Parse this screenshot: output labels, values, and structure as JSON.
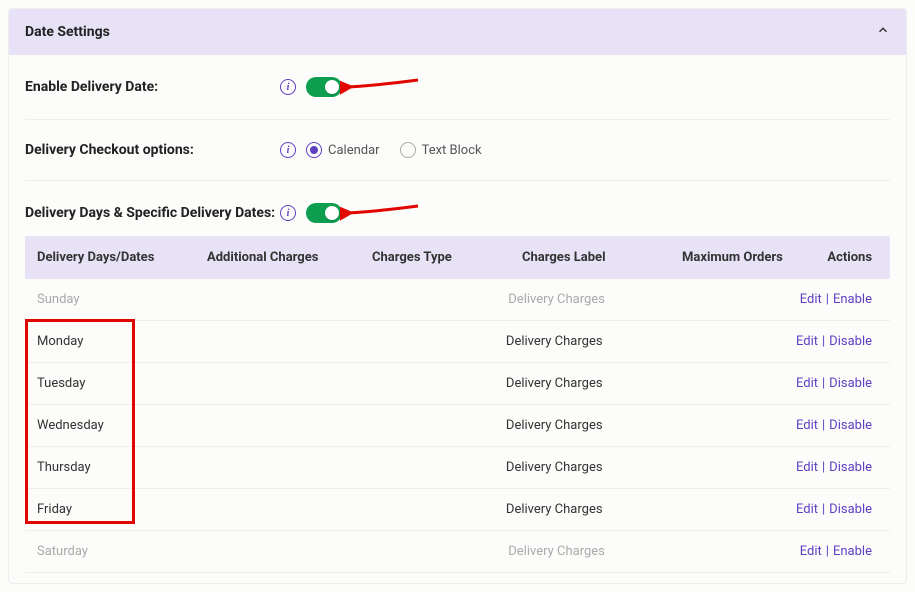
{
  "panel": {
    "title": "Date Settings"
  },
  "settings": {
    "enable_label": "Enable Delivery Date:",
    "checkout_label": "Delivery Checkout options:",
    "checkout_options": {
      "calendar": "Calendar",
      "textblock": "Text Block"
    },
    "days_label": "Delivery Days & Specific Delivery Dates:"
  },
  "table": {
    "headers": {
      "days": "Delivery Days/Dates",
      "charges": "Additional Charges",
      "type": "Charges Type",
      "label": "Charges Label",
      "max": "Maximum Orders",
      "actions": "Actions"
    },
    "rows": [
      {
        "day": "Sunday",
        "label": "Delivery Charges",
        "enabled": false
      },
      {
        "day": "Monday",
        "label": "Delivery Charges",
        "enabled": true
      },
      {
        "day": "Tuesday",
        "label": "Delivery Charges",
        "enabled": true
      },
      {
        "day": "Wednesday",
        "label": "Delivery Charges",
        "enabled": true
      },
      {
        "day": "Thursday",
        "label": "Delivery Charges",
        "enabled": true
      },
      {
        "day": "Friday",
        "label": "Delivery Charges",
        "enabled": true
      },
      {
        "day": "Saturday",
        "label": "Delivery Charges",
        "enabled": false
      }
    ]
  },
  "actions": {
    "edit": "Edit",
    "enable": "Enable",
    "disable": "Disable"
  }
}
